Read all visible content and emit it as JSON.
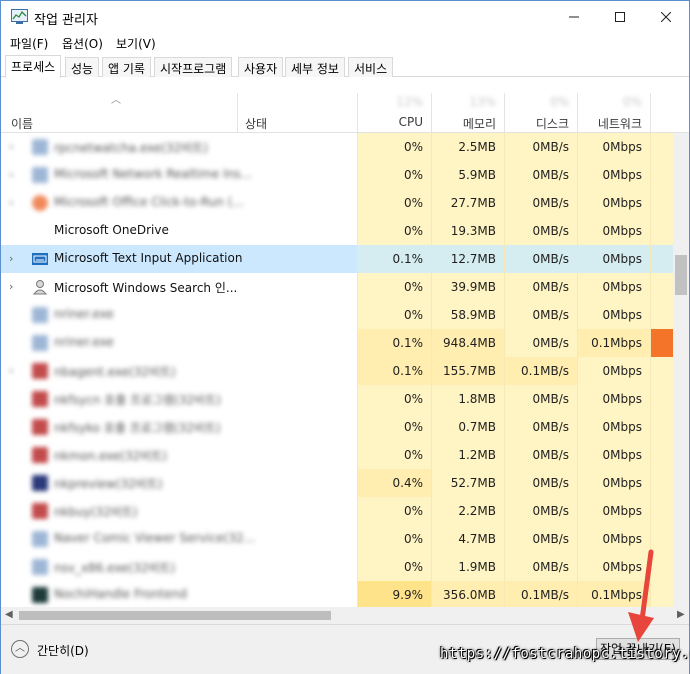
{
  "window": {
    "title": "작업 관리자",
    "controls": {
      "minimize": "─",
      "maximize": "☐",
      "close": "✕"
    }
  },
  "menu": [
    "파일(F)",
    "옵션(O)",
    "보기(V)"
  ],
  "tabs": [
    {
      "label": "프로세스",
      "active": true
    },
    {
      "label": "성능"
    },
    {
      "label": "앱 기록"
    },
    {
      "label": "시작프로그램"
    },
    {
      "label": "사용자"
    },
    {
      "label": "세부 정보"
    },
    {
      "label": "서비스"
    }
  ],
  "columns": {
    "name": "이름",
    "status": "상태",
    "cpu": {
      "label": "CPU",
      "pct": "12%"
    },
    "memory": {
      "label": "메모리",
      "pct": "13%"
    },
    "disk": {
      "label": "디스크",
      "pct": "0%"
    },
    "network": {
      "label": "네트워크",
      "pct": "0%"
    }
  },
  "processes": [
    {
      "name": "rpcnetwatcha.exe(32비트)",
      "expand": true,
      "blurred": true,
      "icon": "gear-icon",
      "icon_color": "#9fb7d6",
      "cpu": "0%",
      "mem": "2.5MB",
      "disk": "0MB/s",
      "net": "0Mbps"
    },
    {
      "name": "Microsoft Network Realtime Ins...",
      "expand": true,
      "blurred": true,
      "icon": "app-icon",
      "icon_color": "#9fb7d6",
      "cpu": "0%",
      "mem": "5.9MB",
      "disk": "0MB/s",
      "net": "0Mbps"
    },
    {
      "name": "Microsoft Office Click-to-Run (...",
      "expand": true,
      "blurred": true,
      "icon": "office-icon",
      "icon_color": "#f08a5d",
      "cpu": "0%",
      "mem": "27.7MB",
      "disk": "0MB/s",
      "net": "0Mbps"
    },
    {
      "name": "Microsoft OneDrive",
      "expand": false,
      "blurred": false,
      "icon": "none",
      "icon_color": "",
      "cpu": "0%",
      "mem": "19.3MB",
      "disk": "0MB/s",
      "net": "0Mbps"
    },
    {
      "name": "Microsoft Text Input Application",
      "expand": true,
      "blurred": false,
      "selected": true,
      "icon": "keyboard-icon",
      "icon_color": "#1e6fbf",
      "cpu": "0.1%",
      "mem": "12.7MB",
      "disk": "0MB/s",
      "net": "0Mbps"
    },
    {
      "name": "Microsoft Windows Search 인...",
      "expand": true,
      "blurred": false,
      "icon": "search-user-icon",
      "icon_color": "#8a8a8a",
      "cpu": "0%",
      "mem": "39.9MB",
      "disk": "0MB/s",
      "net": "0Mbps"
    },
    {
      "name": "nriner.exe",
      "expand": false,
      "blurred": true,
      "icon": "app-icon",
      "icon_color": "#9fb7d6",
      "cpu": "0%",
      "mem": "58.9MB",
      "disk": "0MB/s",
      "net": "0Mbps"
    },
    {
      "name": "nriner.exe",
      "expand": false,
      "blurred": true,
      "icon": "app-icon",
      "icon_color": "#9fb7d6",
      "cpu": "0.1%",
      "mem": "948.4MB",
      "disk": "0MB/s",
      "net": "0.1Mbps",
      "hot": true
    },
    {
      "name": "nbagent.exe(32비트)",
      "expand": true,
      "blurred": true,
      "icon": "app-icon",
      "icon_color": "#c24b4b",
      "cpu": "0.1%",
      "mem": "155.7MB",
      "disk": "0.1MB/s",
      "net": "0Mbps"
    },
    {
      "name": "nkfsycn 호출 프로그램(32비트)",
      "expand": false,
      "blurred": true,
      "icon": "app-icon",
      "icon_color": "#c24b4b",
      "cpu": "0%",
      "mem": "1.8MB",
      "disk": "0MB/s",
      "net": "0Mbps"
    },
    {
      "name": "nkfsyko 호출 프로그램(32비트)",
      "expand": false,
      "blurred": true,
      "icon": "app-icon",
      "icon_color": "#c24b4b",
      "cpu": "0%",
      "mem": "0.7MB",
      "disk": "0MB/s",
      "net": "0Mbps"
    },
    {
      "name": "nkmon.exe(32비트)",
      "expand": false,
      "blurred": true,
      "icon": "app-icon",
      "icon_color": "#c24b4b",
      "cpu": "0%",
      "mem": "1.2MB",
      "disk": "0MB/s",
      "net": "0Mbps"
    },
    {
      "name": "nkpreview(32비트)",
      "expand": false,
      "blurred": true,
      "icon": "app-icon",
      "icon_color": "#2a3a7a",
      "cpu": "0.4%",
      "mem": "52.7MB",
      "disk": "0MB/s",
      "net": "0Mbps"
    },
    {
      "name": "nkbuy(32비트)",
      "expand": false,
      "blurred": true,
      "icon": "app-icon",
      "icon_color": "#c24b4b",
      "cpu": "0%",
      "mem": "2.2MB",
      "disk": "0MB/s",
      "net": "0Mbps"
    },
    {
      "name": "Naver Comic Viewer Service(32...",
      "expand": false,
      "blurred": true,
      "icon": "app-icon",
      "icon_color": "#9fb7d6",
      "cpu": "0%",
      "mem": "4.7MB",
      "disk": "0MB/s",
      "net": "0Mbps"
    },
    {
      "name": "nsv_x86.exe(32비트)",
      "expand": false,
      "blurred": true,
      "icon": "app-icon",
      "icon_color": "#9fb7d6",
      "cpu": "0%",
      "mem": "1.9MB",
      "disk": "0MB/s",
      "net": "0Mbps"
    },
    {
      "name": "NochiHandle Frontend",
      "expand": false,
      "blurred": true,
      "icon": "app-icon",
      "icon_color": "#1e3a3a",
      "cpu": "9.9%",
      "mem": "356.0MB",
      "disk": "0.1MB/s",
      "net": "0.1Mbps",
      "cpu_hot": true
    }
  ],
  "footer": {
    "fewer_details": "간단히(D)",
    "end_task": "작업 끝내기(E)"
  },
  "watermark": "https://fostcrahopc.tistory.com"
}
